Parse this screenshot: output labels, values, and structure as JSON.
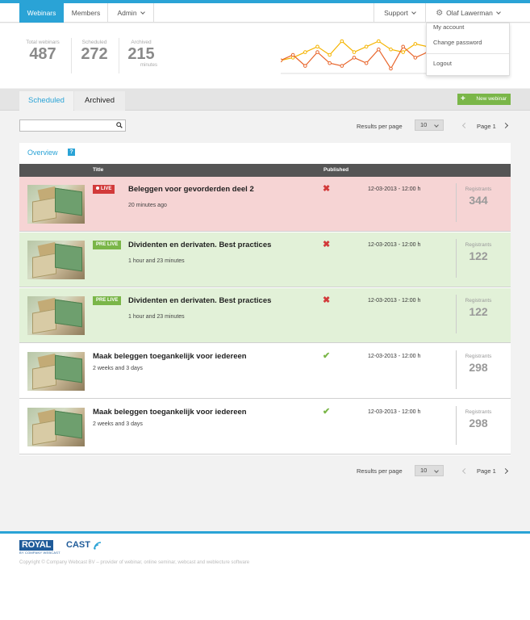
{
  "nav": {
    "tabs": [
      {
        "label": "Webinars",
        "active": true
      },
      {
        "label": "Members",
        "active": false
      },
      {
        "label": "Admin",
        "active": false
      }
    ],
    "support_label": "Support",
    "user_label": "Olaf Lawerman"
  },
  "user_menu": {
    "items": [
      "My account",
      "Change password",
      "Logout"
    ]
  },
  "stats": [
    {
      "label": "Total webinars",
      "value": "487",
      "sub": ""
    },
    {
      "label": "Scheduled",
      "value": "272",
      "sub": ""
    },
    {
      "label": "Archived",
      "value": "215",
      "sub": "minutes"
    }
  ],
  "sparkline": {
    "series": [
      {
        "color": "#f5b400",
        "values": [
          5,
          6,
          8,
          10,
          7,
          12,
          8,
          10,
          12,
          9,
          8,
          11,
          10
        ]
      },
      {
        "color": "#e8652b",
        "values": [
          5,
          7,
          3,
          8,
          4,
          3,
          6,
          4,
          9,
          2,
          10,
          6,
          8
        ]
      }
    ]
  },
  "tabs": [
    {
      "label": "Scheduled",
      "active": true
    },
    {
      "label": "Archived",
      "active": false
    }
  ],
  "new_webinar_label": "New webinar",
  "controls": {
    "results_per_page_label": "Results per page",
    "per_page_value": "10",
    "page_label": "Page 1",
    "search_placeholder": ""
  },
  "overview": {
    "title": "Overview",
    "help_glyph": "?",
    "columns": {
      "title": "Title",
      "published": "Published"
    },
    "rows": [
      {
        "status": "live",
        "badge": "LIVE",
        "title": "Beleggen voor gevorderden deel 2",
        "subtitle": "20 minutes ago",
        "published": "✖",
        "date": "12-03-2013 - 12:00 h",
        "registrants_label": "Registrants",
        "registrants": "344"
      },
      {
        "status": "pre",
        "badge": "PRE LIVE",
        "title": "Dividenten en derivaten. Best practices",
        "subtitle": "1 hour and 23 minutes",
        "published": "✖",
        "date": "12-03-2013 - 12:00 h",
        "registrants_label": "Registrants",
        "registrants": "122"
      },
      {
        "status": "pre",
        "badge": "PRE LIVE",
        "title": "Dividenten en derivaten. Best practices",
        "subtitle": "1 hour and 23 minutes",
        "published": "✖",
        "date": "12-03-2013 - 12:00 h",
        "registrants_label": "Registrants",
        "registrants": "122"
      },
      {
        "status": "normal",
        "badge": "",
        "title": "Maak beleggen toegankelijk voor iedereen",
        "subtitle": "2 weeks and 3 days",
        "published": "✔",
        "date": "12-03-2013 - 12:00 h",
        "registrants_label": "Registrants",
        "registrants": "298"
      },
      {
        "status": "normal",
        "badge": "",
        "title": "Maak beleggen toegankelijk voor iedereen",
        "subtitle": "2 weeks and 3 days",
        "published": "✔",
        "date": "12-03-2013 - 12:00 h",
        "registrants_label": "Registrants",
        "registrants": "298"
      }
    ]
  },
  "footer": {
    "logo_royal": "ROYAL",
    "logo_cast": "CAST",
    "logo_tagline": "BY COMPANY WEBCAST",
    "copyright": "Copyright © Company Webcast BV – provider of webinar, online seminar, webcast and weblecture software"
  }
}
